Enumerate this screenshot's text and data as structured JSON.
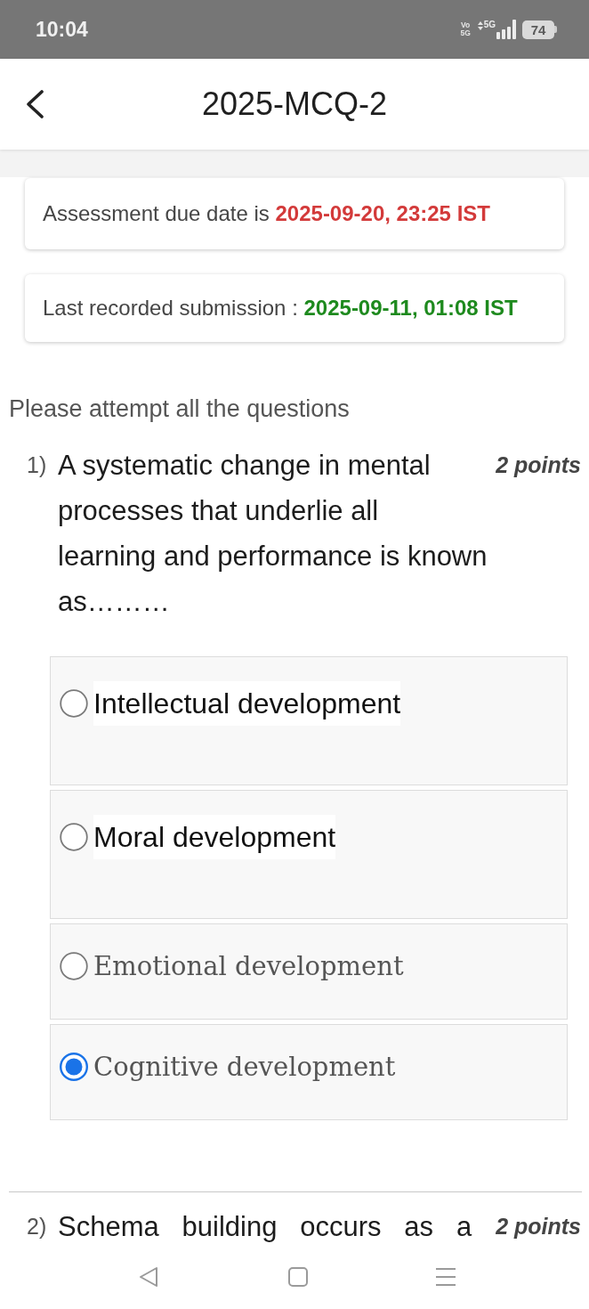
{
  "status_bar": {
    "time": "10:04",
    "volte": "Vo 5G",
    "network": "5G",
    "battery": "74"
  },
  "header": {
    "title": "2025-MCQ-2"
  },
  "notices": [
    {
      "label": "Assessment due date is",
      "value": "2025-09-20, 23:25 IST",
      "color": "#d33a3a"
    },
    {
      "label": "Last recorded submission :",
      "value": "2025-09-11, 01:08 IST",
      "color": "#1e8a1e"
    }
  ],
  "instructions": "Please attempt all the questions",
  "questions": [
    {
      "number": "1)",
      "text": "A systematic change in mental processes that underlie all learning and performance is known as………",
      "points": "2 points",
      "justified": false,
      "options": [
        {
          "label": "Intellectual development",
          "kind": "sans",
          "selected": false
        },
        {
          "label": "Moral development",
          "kind": "sans",
          "selected": false
        },
        {
          "label": "Emotional development",
          "kind": "serif",
          "selected": false
        },
        {
          "label": "Cognitive development",
          "kind": "serif",
          "selected": true
        }
      ]
    },
    {
      "number": "2)",
      "text": "Schema building occurs as a",
      "points": "2 points",
      "justified": true
    }
  ]
}
